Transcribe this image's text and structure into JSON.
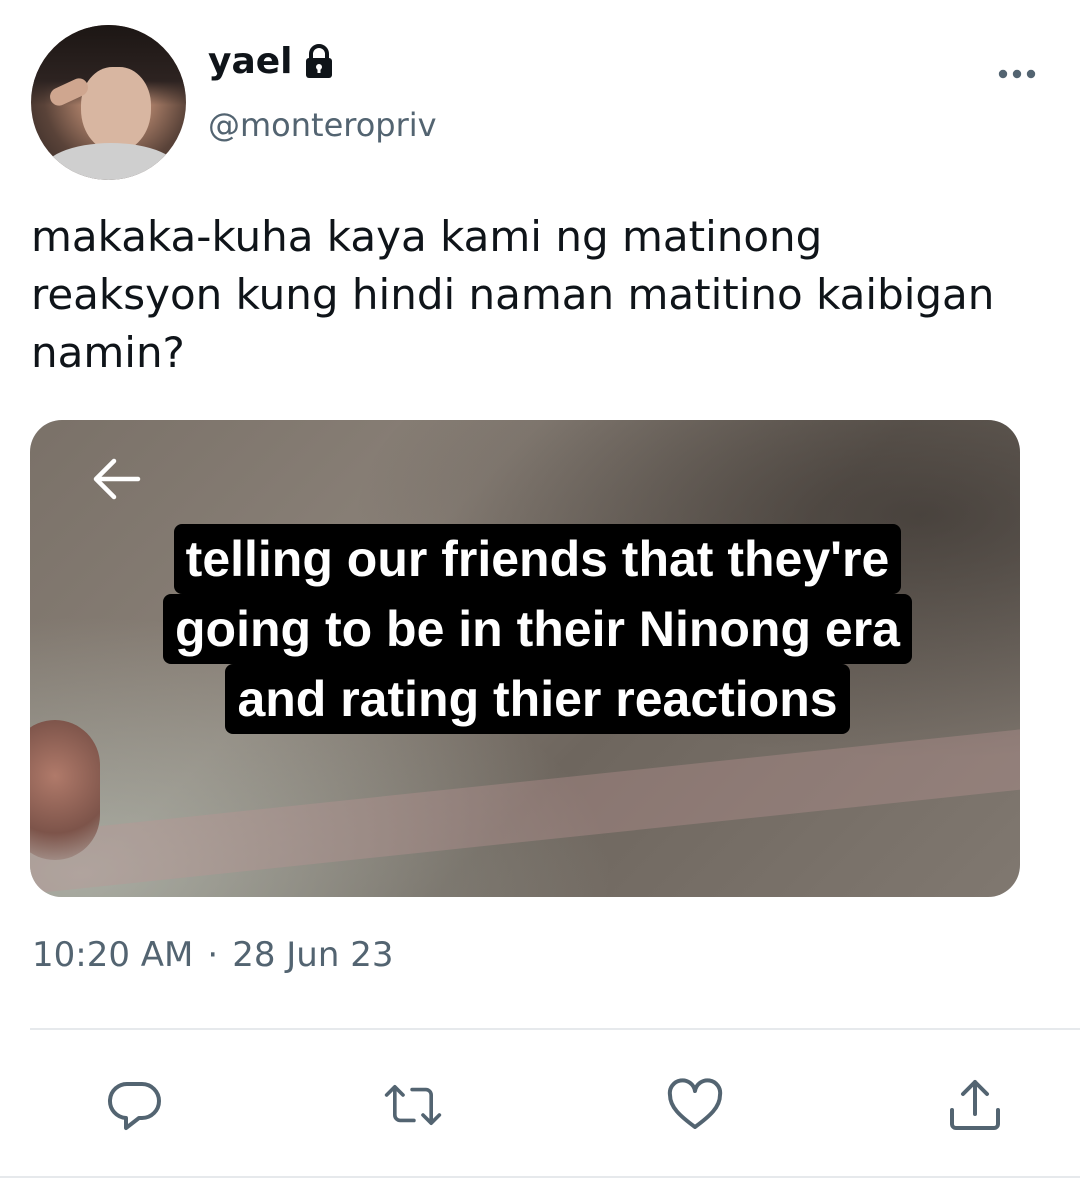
{
  "author": {
    "display_name": "yael",
    "handle": "@monteropriv",
    "protected_icon": "lock-icon",
    "avatar_icon": "avatar"
  },
  "tweet": {
    "text": "makaka-kuha kaya kami ng matinong\nreaksyon kung hindi naman matitino kaibigan\nnamin?",
    "time": "10:20 AM",
    "separator": "·",
    "date": "28 Jun 23"
  },
  "media": {
    "caption_lines": [
      "telling our friends that they're",
      "going to be in their Ninong era",
      "and rating thier reactions"
    ],
    "back_icon": "back-arrow-icon"
  },
  "actions": {
    "reply_icon": "reply-icon",
    "retweet_icon": "retweet-icon",
    "like_icon": "heart-icon",
    "share_icon": "share-icon",
    "more_icon": "more-icon"
  },
  "colors": {
    "text": "#0f1419",
    "secondary": "#536471",
    "icon": "#536471",
    "divider": "#e6e9ec",
    "caption_bg": "#000000",
    "caption_text": "#ffffff"
  }
}
